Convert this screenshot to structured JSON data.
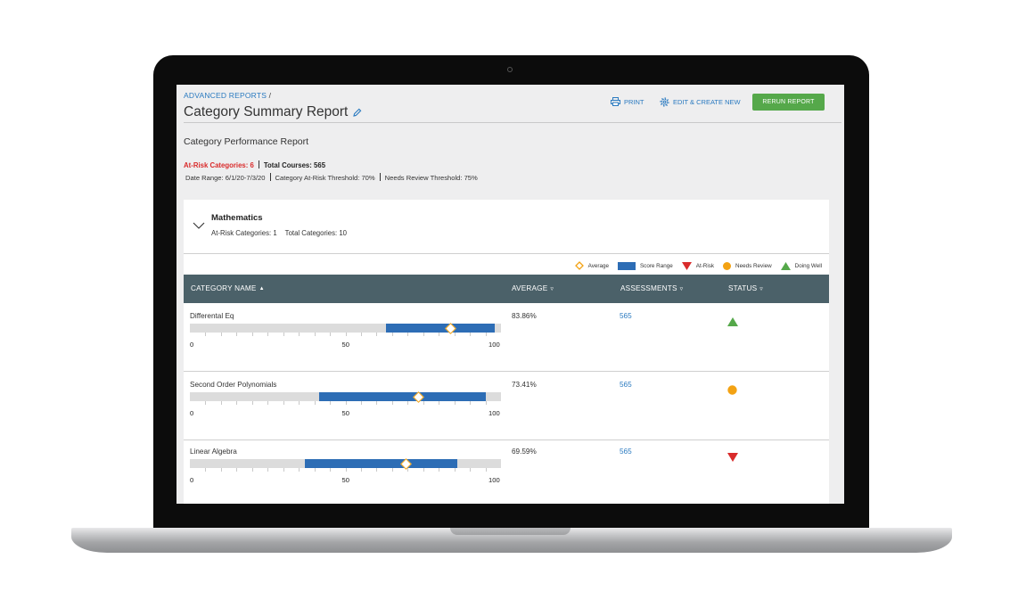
{
  "header": {
    "breadcrumb": "ADVANCED REPORTS",
    "breadcrumb_sep": "/",
    "title": "Category Summary Report",
    "print_label": "PRINT",
    "edit_label": "EDIT & CREATE NEW",
    "rerun_label": "RERUN REPORT"
  },
  "report": {
    "subtitle": "Category Performance Report",
    "at_risk_label": "At-Risk Categories: 6",
    "total_courses_label": "Total Courses: 565",
    "date_range": "Date Range: 6/1/20-7/3/20",
    "at_risk_threshold": "Category At-Risk Threshold: 70%",
    "needs_review_threshold": "Needs Review Threshold: 75%"
  },
  "group": {
    "name": "Mathematics",
    "at_risk": "At-Risk Categories: 1",
    "total": "Total Categories: 10"
  },
  "legend": {
    "average": "Average",
    "score_range": "Score Range",
    "at_risk": "At-Risk",
    "needs_review": "Needs Review",
    "doing_well": "Doing Well"
  },
  "colors": {
    "at_risk": "#d92b2b",
    "needs_review": "#f3a213",
    "doing_well": "#55a84a",
    "score_range": "#2d6db5",
    "table_header": "#4b6169"
  },
  "table": {
    "headers": [
      "CATEGORY NAME",
      "AVERAGE",
      "ASSESSMENTS",
      "STATUS"
    ],
    "axis_labels": [
      "0",
      "50",
      "100"
    ],
    "rows": [
      {
        "name": "Differental Eq",
        "average": "83.86%",
        "assessments": "565",
        "status": "doing-well",
        "range_min": 63,
        "range_max": 98,
        "avg_value": 83.86
      },
      {
        "name": "Second Order Polynomials",
        "average": "73.41%",
        "assessments": "565",
        "status": "needs-review",
        "range_min": 41.5,
        "range_max": 95,
        "avg_value": 73.41
      },
      {
        "name": "Linear Algebra",
        "average": "69.59%",
        "assessments": "565",
        "status": "at-risk",
        "range_min": 37,
        "range_max": 86,
        "avg_value": 69.59
      }
    ]
  }
}
